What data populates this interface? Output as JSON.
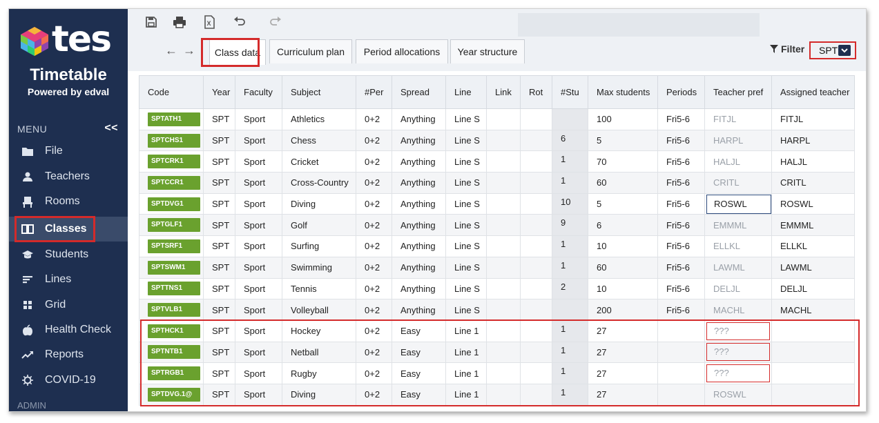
{
  "brand": {
    "wordmark": "tes",
    "title": "Timetable",
    "powered_by": "Powered by edval"
  },
  "menu": {
    "header": "MENU",
    "collapse": "<<",
    "items": [
      {
        "label": "File",
        "icon": "folder-icon"
      },
      {
        "label": "Teachers",
        "icon": "person-icon"
      },
      {
        "label": "Rooms",
        "icon": "chair-icon"
      },
      {
        "label": "Classes",
        "icon": "book-icon",
        "active": true
      },
      {
        "label": "Students",
        "icon": "graduation-cap-icon"
      },
      {
        "label": "Lines",
        "icon": "lines-icon"
      },
      {
        "label": "Grid",
        "icon": "grid-icon"
      },
      {
        "label": "Health Check",
        "icon": "apple-icon"
      },
      {
        "label": "Reports",
        "icon": "trend-chart-icon"
      },
      {
        "label": "COVID-19",
        "icon": "virus-icon"
      }
    ],
    "admin_label": "ADMIN"
  },
  "toolbar": {
    "icons": [
      "save-icon",
      "print-icon",
      "export-excel-icon",
      "undo-icon",
      "redo-icon"
    ],
    "back_arrow": "←",
    "forward_arrow": "→",
    "tabs": [
      "Class data",
      "Curriculum plan",
      "Period allocations",
      "Year structure"
    ],
    "active_tab": "Class data",
    "filter_label": "Filter",
    "year_value": "SPT"
  },
  "table": {
    "columns": [
      "Code",
      "Year",
      "Faculty",
      "Subject",
      "#Per",
      "Spread",
      "Line",
      "Link",
      "Rot",
      "#Stu",
      "Max students",
      "Periods",
      "Teacher pref",
      "Assigned teacher"
    ],
    "rows": [
      {
        "code": "SPTATH1",
        "year": "SPT",
        "faculty": "Sport",
        "subject": "Athletics",
        "per": "0+2",
        "spread": "Anything",
        "line": "Line S",
        "link": "",
        "rot": "",
        "stu": "",
        "max": "100",
        "periods": "Fri5-6",
        "pref": "FITJL",
        "assigned": "FITJL"
      },
      {
        "code": "SPTCHS1",
        "year": "SPT",
        "faculty": "Sport",
        "subject": "Chess",
        "per": "0+2",
        "spread": "Anything",
        "line": "Line S",
        "link": "",
        "rot": "",
        "stu": "6",
        "max": "5",
        "periods": "Fri5-6",
        "pref": "HARPL",
        "assigned": "HARPL"
      },
      {
        "code": "SPTCRK1",
        "year": "SPT",
        "faculty": "Sport",
        "subject": "Cricket",
        "per": "0+2",
        "spread": "Anything",
        "line": "Line S",
        "link": "",
        "rot": "",
        "stu": "1",
        "max": "70",
        "periods": "Fri5-6",
        "pref": "HALJL",
        "assigned": "HALJL"
      },
      {
        "code": "SPTCCR1",
        "year": "SPT",
        "faculty": "Sport",
        "subject": "Cross-Country",
        "per": "0+2",
        "spread": "Anything",
        "line": "Line S",
        "link": "",
        "rot": "",
        "stu": "1",
        "max": "60",
        "periods": "Fri5-6",
        "pref": "CRITL",
        "assigned": "CRITL"
      },
      {
        "code": "SPTDVG1",
        "year": "SPT",
        "faculty": "Sport",
        "subject": "Diving",
        "per": "0+2",
        "spread": "Anything",
        "line": "Line S",
        "link": "",
        "rot": "",
        "stu": "10",
        "max": "5",
        "periods": "Fri5-6",
        "pref": "ROSWL",
        "assigned": "ROSWL"
      },
      {
        "code": "SPTGLF1",
        "year": "SPT",
        "faculty": "Sport",
        "subject": "Golf",
        "per": "0+2",
        "spread": "Anything",
        "line": "Line S",
        "link": "",
        "rot": "",
        "stu": "9",
        "max": "6",
        "periods": "Fri5-6",
        "pref": "EMMML",
        "assigned": "EMMML"
      },
      {
        "code": "SPTSRF1",
        "year": "SPT",
        "faculty": "Sport",
        "subject": "Surfing",
        "per": "0+2",
        "spread": "Anything",
        "line": "Line S",
        "link": "",
        "rot": "",
        "stu": "1",
        "max": "10",
        "periods": "Fri5-6",
        "pref": "ELLKL",
        "assigned": "ELLKL"
      },
      {
        "code": "SPTSWM1",
        "year": "SPT",
        "faculty": "Sport",
        "subject": "Swimming",
        "per": "0+2",
        "spread": "Anything",
        "line": "Line S",
        "link": "",
        "rot": "",
        "stu": "1",
        "max": "60",
        "periods": "Fri5-6",
        "pref": "LAWML",
        "assigned": "LAWML"
      },
      {
        "code": "SPTTNS1",
        "year": "SPT",
        "faculty": "Sport",
        "subject": "Tennis",
        "per": "0+2",
        "spread": "Anything",
        "line": "Line S",
        "link": "",
        "rot": "",
        "stu": "2",
        "max": "10",
        "periods": "Fri5-6",
        "pref": "DELJL",
        "assigned": "DELJL"
      },
      {
        "code": "SPTVLB1",
        "year": "SPT",
        "faculty": "Sport",
        "subject": "Volleyball",
        "per": "0+2",
        "spread": "Anything",
        "line": "Line S",
        "link": "",
        "rot": "",
        "stu": "",
        "max": "200",
        "periods": "Fri5-6",
        "pref": "MACHL",
        "assigned": "MACHL"
      },
      {
        "code": "SPTHCK1",
        "year": "SPT",
        "faculty": "Sport",
        "subject": "Hockey",
        "per": "0+2",
        "spread": "Easy",
        "line": "Line 1",
        "link": "",
        "rot": "",
        "stu": "1",
        "max": "27",
        "periods": "",
        "pref": "???",
        "assigned": ""
      },
      {
        "code": "SPTNTB1",
        "year": "SPT",
        "faculty": "Sport",
        "subject": "Netball",
        "per": "0+2",
        "spread": "Easy",
        "line": "Line 1",
        "link": "",
        "rot": "",
        "stu": "1",
        "max": "27",
        "periods": "",
        "pref": "???",
        "assigned": ""
      },
      {
        "code": "SPTRGB1",
        "year": "SPT",
        "faculty": "Sport",
        "subject": "Rugby",
        "per": "0+2",
        "spread": "Easy",
        "line": "Line 1",
        "link": "",
        "rot": "",
        "stu": "1",
        "max": "27",
        "periods": "",
        "pref": "???",
        "assigned": ""
      },
      {
        "code": "SPTDVG.1@",
        "year": "SPT",
        "faculty": "Sport",
        "subject": "Diving",
        "per": "0+2",
        "spread": "Easy",
        "line": "Line 1",
        "link": "",
        "rot": "",
        "stu": "1",
        "max": "27",
        "periods": "",
        "pref": "ROSWL",
        "assigned": ""
      }
    ]
  },
  "colors": {
    "sidebar": "#1e2f50",
    "badge": "#6aa12e",
    "highlight": "#d42a2a"
  }
}
